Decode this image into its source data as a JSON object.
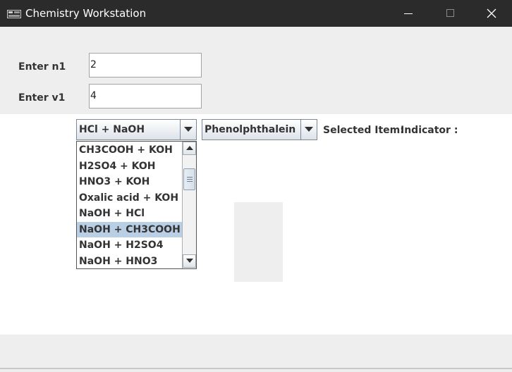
{
  "window": {
    "title": "Chemistry Workstation"
  },
  "form": {
    "n1_label": "Enter n1",
    "n1_value": "2",
    "v1_label": "Enter v1",
    "v1_value": "4"
  },
  "reaction_combo": {
    "selected": "HCl + NaOH"
  },
  "indicator_combo": {
    "selected": "Phenolphthalein"
  },
  "labels": {
    "selected_item": "Selected Item:",
    "indicator": "Indicator :"
  },
  "reaction_list": {
    "items": [
      "CH3COOH + KOH",
      "H2SO4 + KOH",
      "HNO3 + KOH",
      "Oxalic acid + KOH",
      "NaOH + HCl",
      "NaOH + CH3COOH",
      "NaOH + H2SO4",
      "NaOH + HNO3"
    ],
    "highlighted": "NaOH + CH3COOH"
  },
  "colors": {
    "titlebar": "#2b2b2b",
    "panel": "#eeeeee",
    "highlight": "#b8cfe5"
  }
}
